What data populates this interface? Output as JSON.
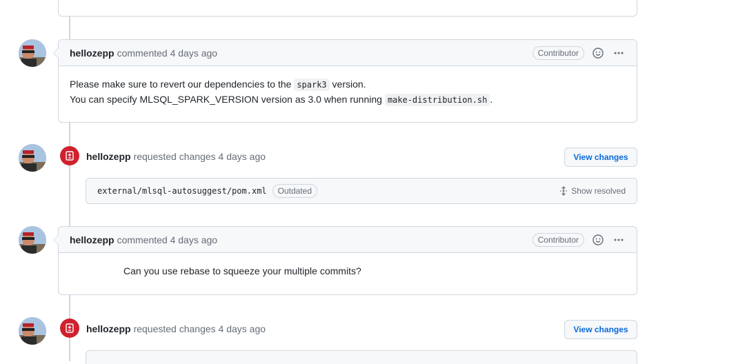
{
  "comments": [
    {
      "author": "hellozepp",
      "action": "commented 4 days ago",
      "badge": "Contributor",
      "line1_before": "Please make sure to revert our dependencies to the ",
      "line1_code": "spark3",
      "line1_after": " version.",
      "line2_before": "You can specify MLSQL_SPARK_VERSION version as 3.0 when running ",
      "line2_code": "make-distribution.sh",
      "line2_after": "."
    },
    {
      "author": "hellozepp",
      "action": "commented 4 days ago",
      "badge": "Contributor",
      "body": "Can you use rebase to squeeze your multiple commits?"
    }
  ],
  "reviews": [
    {
      "author": "hellozepp",
      "action": "requested changes 4 days ago",
      "button": "View changes",
      "file_path": "external/mlsql-autosuggest/pom.xml",
      "file_badge": "Outdated",
      "show_resolved": "Show resolved"
    },
    {
      "author": "hellozepp",
      "action": "requested changes 4 days ago",
      "button": "View changes"
    }
  ],
  "colors": {
    "accent": "#0969da",
    "danger": "#cf222e",
    "border": "#d0d7de",
    "header_bg": "#f6f8fa"
  },
  "icons": {
    "review": "file-diff-icon",
    "reaction": "smiley-icon",
    "menu": "kebab-horizontal-icon",
    "unfold": "unfold-icon"
  }
}
